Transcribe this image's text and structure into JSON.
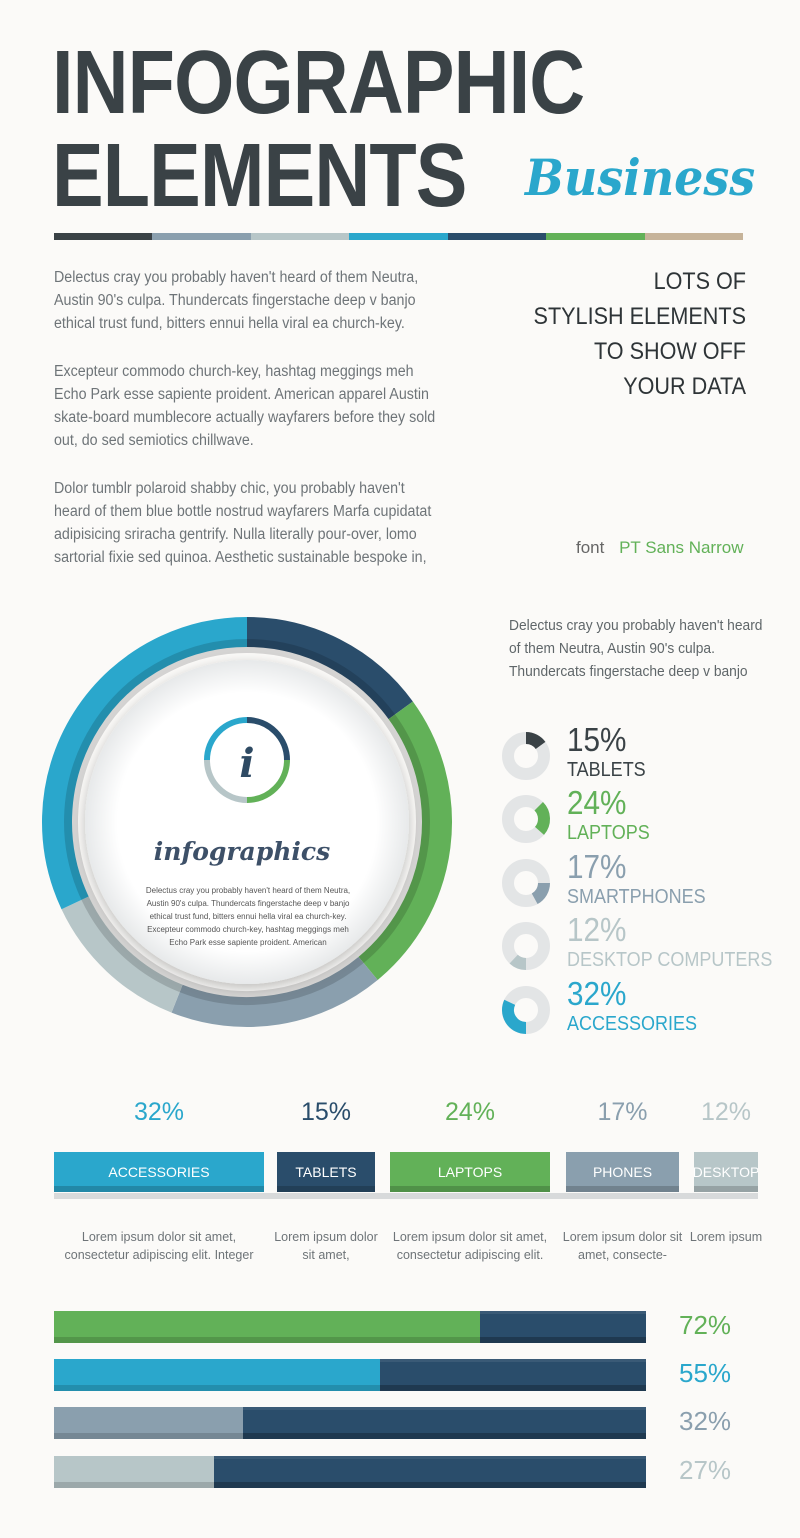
{
  "header": {
    "title_line1": "INFOGRAPHIC",
    "title_line2": "ELEMENTS",
    "script_word": "Business"
  },
  "colors": {
    "dark": "#3a4246",
    "grey_blue": "#8a9fae",
    "light_grey": "#b7c6c8",
    "cyan": "#2aa7cc",
    "navy": "#2a4d6b",
    "green": "#62b158",
    "tan": "#c6b39a"
  },
  "intro": {
    "paragraphs": [
      "Delectus cray you probably haven't heard of them Neutra, Austin 90's culpa. Thundercats fingerstache deep v banjo ethical trust fund, bitters ennui hella viral ea church-key.",
      "Excepteur commodo church-key, hashtag meggings meh Echo Park esse sapiente proident. American apparel Austin skate-board mumblecore actually wayfarers before they sold out, do sed semiotics chillwave.",
      "Dolor tumblr polaroid shabby chic, you probably haven't heard of them blue bottle nostrud wayfarers Marfa cupidatat adipisicing sriracha gentrify. Nulla literally pour-over, lomo sartorial fixie sed quinoa. Aesthetic sustainable bespoke in,"
    ],
    "tagline_lines": [
      "LOTS OF",
      "STYLISH ELEMENTS",
      "TO SHOW OFF",
      "YOUR DATA"
    ],
    "font_label": "font",
    "font_value": "PT Sans Narrow"
  },
  "ring": {
    "icon_letter": "i",
    "title": "infographics",
    "body": "Delectus cray you probably haven't heard of them Neutra, Austin 90's culpa. Thundercats fingerstache deep v banjo ethical trust fund, bitters ennui hella viral ea church-key.  Excepteur commodo church-key, hashtag meggings meh Echo Park esse sapiente proident. American"
  },
  "side_text": "Delectus cray you probably haven't heard of them Neutra, Austin 90's culpa. Thundercats fingerstache deep v banjo",
  "chart_data": [
    {
      "type": "pie",
      "categories": [
        "TABLETS",
        "LAPTOPS",
        "SMARTPHONES",
        "DESKTOP COMPUTERS",
        "ACCESSORIES"
      ],
      "values": [
        15,
        24,
        17,
        12,
        32
      ],
      "value_labels": [
        "15%",
        "24%",
        "17%",
        "12%",
        "32%"
      ],
      "colors": [
        "#3a4246",
        "#62b158",
        "#8a9fae",
        "#b7c6c8",
        "#2aa7cc"
      ]
    },
    {
      "type": "bar",
      "categories": [
        "ACCESSORIES",
        "TABLETS",
        "LAPTOPS",
        "PHONES",
        "DESKTOP"
      ],
      "values": [
        32,
        15,
        24,
        17,
        12
      ],
      "value_labels": [
        "32%",
        "15%",
        "24%",
        "17%",
        "12%"
      ],
      "colors": [
        "#2aa7cc",
        "#2a4d6b",
        "#62b158",
        "#8a9fae",
        "#b7c6c8"
      ],
      "descriptions": [
        "Lorem ipsum dolor sit amet, consectetur adipiscing elit. Integer",
        "Lorem ipsum dolor sit amet,",
        "Lorem ipsum dolor sit amet, consectetur adipiscing elit.",
        "Lorem ipsum dolor sit amet, consecte-",
        "Lorem ipsum"
      ]
    },
    {
      "type": "bar",
      "orientation": "horizontal",
      "values": [
        72,
        55,
        32,
        27
      ],
      "value_labels": [
        "72%",
        "55%",
        "32%",
        "27%"
      ],
      "colors": [
        "#62b158",
        "#2aa7cc",
        "#8a9fae",
        "#b7c6c8"
      ],
      "track_color": "#2a4d6b",
      "xlim": [
        0,
        100
      ]
    }
  ]
}
